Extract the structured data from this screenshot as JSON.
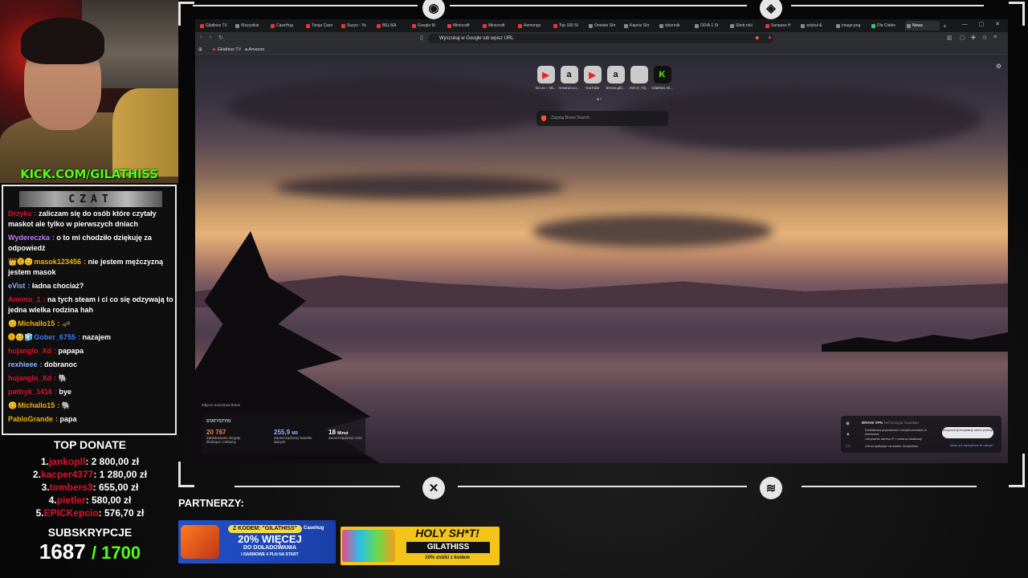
{
  "overlay": {
    "kick_url": "KICK.COM/GILATHISS",
    "chat_title": "CZAT",
    "chat": [
      {
        "badges": "",
        "user": "Drzyks",
        "user_color": "#e0102a",
        "text": "zaliczam się do osób które czytały maskot ale tylko w pierwszych dniach"
      },
      {
        "badges": "",
        "user": "Wydereczka",
        "user_color": "#c27aff",
        "text": "o to mi chodziło dziękuję za odpowiedź"
      },
      {
        "badges": "👑🅘😊",
        "user": "masok123456",
        "user_color": "#f0b400",
        "text": "nie jestem mężczyzną jestem masok"
      },
      {
        "badges": "",
        "user": "eVist",
        "user_color": "#8ab4ff",
        "text": "ładna chociaż?"
      },
      {
        "badges": "",
        "user": "Anemo_1",
        "user_color": "#e0102a",
        "text": "na tych steam i ci co się odzywają to jedna wielka rodzina hah"
      },
      {
        "badges": "😊",
        "user": "Michallo15",
        "user_color": "#f0b400",
        "text": "🛹"
      },
      {
        "badges": "🅘😊🧊",
        "user": "Gober_6755",
        "user_color": "#3a7bff",
        "text": "nazajem"
      },
      {
        "badges": "",
        "user": "hujanglo_Xd",
        "user_color": "#e0102a",
        "text": "papapa"
      },
      {
        "badges": "",
        "user": "rexhieee",
        "user_color": "#8ab4ff",
        "text": "dobranoc"
      },
      {
        "badges": "",
        "user": "hujanglo_Xd",
        "user_color": "#e0102a",
        "text": "🐘"
      },
      {
        "badges": "",
        "user": "pattryk_1416",
        "user_color": "#e0102a",
        "text": "bye"
      },
      {
        "badges": "😊",
        "user": "Michallo15",
        "user_color": "#f0b400",
        "text": "🐘"
      },
      {
        "badges": "",
        "user": "PabloGrande",
        "user_color": "#f0b400",
        "text": "papa"
      }
    ],
    "top_donate": {
      "title": "TOP DONATE",
      "items": [
        {
          "rank": "1.",
          "name": "jankopll",
          "amount": "2 800,00 zł"
        },
        {
          "rank": "2.",
          "name": "kacper4377",
          "amount": "1 280,00 zł"
        },
        {
          "rank": "3.",
          "name": "tombers3",
          "amount": "655,00 zł"
        },
        {
          "rank": "4.",
          "name": "pietler",
          "amount": "580,00 zł"
        },
        {
          "rank": "5.",
          "name": "EPICKepcio",
          "amount": "576,70 zł"
        }
      ]
    },
    "subs": {
      "title": "SUBSKRYPCJE",
      "current": "1687",
      "goal": "/ 1700"
    },
    "partners": {
      "label": "PARTNERZY:",
      "case": {
        "code": "Z KODEM: \"GILATHISS\"",
        "logo": "Casehug",
        "big": "20% WIĘCEJ",
        "sub": "DO DOŁADOWANIA",
        "sub2": "I DARMOWE 4 PLN NA START"
      },
      "holy": {
        "brand": "HOLY SH*T!",
        "code": "GILATHISS",
        "discount": "10% zniżki z kodem"
      }
    }
  },
  "browser": {
    "tabs": [
      {
        "label": "Gilathiss TV",
        "color": "#e33"
      },
      {
        "label": "Wszystkie",
        "color": "#888"
      },
      {
        "label": "CaseHug",
        "color": "#e33"
      },
      {
        "label": "Twoja Case",
        "color": "#e33"
      },
      {
        "label": "Suzyn - Yo",
        "color": "#e33"
      },
      {
        "label": "BELISA",
        "color": "#e33"
      },
      {
        "label": "Google M",
        "color": "#e33"
      },
      {
        "label": "Minecraft",
        "color": "#e33"
      },
      {
        "label": "Minecraft",
        "color": "#e33"
      },
      {
        "label": "Aemongo",
        "color": "#e33"
      },
      {
        "label": "Top 100 St",
        "color": "#e33"
      },
      {
        "label": "Oneiste Shr",
        "color": "#888"
      },
      {
        "label": "Kapcie Shr",
        "color": "#888"
      },
      {
        "label": "dziennik",
        "color": "#888"
      },
      {
        "label": "ODIA 1 St",
        "color": "#888"
      },
      {
        "label": "Slirdr.roki",
        "color": "#888"
      },
      {
        "label": "Suripass H",
        "color": "#e33"
      },
      {
        "label": "artykuł &",
        "color": "#888"
      },
      {
        "label": "image.png",
        "color": "#888"
      },
      {
        "label": "Dla Ciebie",
        "color": "#2ecc71"
      },
      {
        "label": "Nowa",
        "color": "#888",
        "active": true
      }
    ],
    "new_tab_icon": "+",
    "url_placeholder": "Wyszukaj w Google lub wpisz URL",
    "bookmarks": [
      "Gilathiss TV",
      "Amazon"
    ],
    "shortcuts": [
      {
        "label": "Go-Jo – Mi...",
        "icon": "youtube-icon",
        "glyph": "▶",
        "glyph_color": "#e22"
      },
      {
        "label": "Amazon.co...",
        "icon": "amazon-icon",
        "glyph": "a",
        "glyph_color": "#111"
      },
      {
        "label": "YouTube",
        "icon": "youtube-icon",
        "glyph": "▶",
        "glyph_color": "#e22"
      },
      {
        "label": "Strona głó...",
        "icon": "amazon-icon",
        "glyph": "a",
        "glyph_color": "#111"
      },
      {
        "label": "AOI zl_7Q...",
        "icon": "blank-icon",
        "glyph": "",
        "glyph_color": "#111"
      },
      {
        "label": "Gilathiss St...",
        "icon": "kick-icon",
        "glyph": "K",
        "glyph_color": "#53fc18"
      }
    ],
    "search_placeholder": "Zapytaj Brave Search",
    "photo_credit": "Zdjęcie autorstwa Brave",
    "stats": {
      "title": "STATYSTYKI",
      "items": [
        {
          "value": "20 767",
          "unit": "",
          "label": "Zablokowane skrypty śledzące i reklamy",
          "color": "#ff7a45"
        },
        {
          "value": "255,9",
          "unit": "MB",
          "label": "Zaoszczędzony transfer danych",
          "color": "#8fb4ff"
        },
        {
          "value": "18",
          "unit": "Minut",
          "label": "Zaoszczędzony czas",
          "color": "#ffffff"
        }
      ]
    },
    "vpn": {
      "title": "BRAVE VPN",
      "powered": "Technologia Guardian",
      "features": [
        "Dodatkowa prywatność i bezpieczeństwo w Internecie",
        "Ukrywanie adresu IP i zmiana lokalizacji",
        "Chroń aplikacje na swoim urządzeniu"
      ],
      "button": "Rozpocznij bezpłatny okres próbny",
      "link": "Masz już wykupione te usługi?"
    }
  },
  "colors": {
    "kick_green": "#53fc18",
    "donate_name": "#e0102a",
    "frame": "#e6e6e6"
  }
}
